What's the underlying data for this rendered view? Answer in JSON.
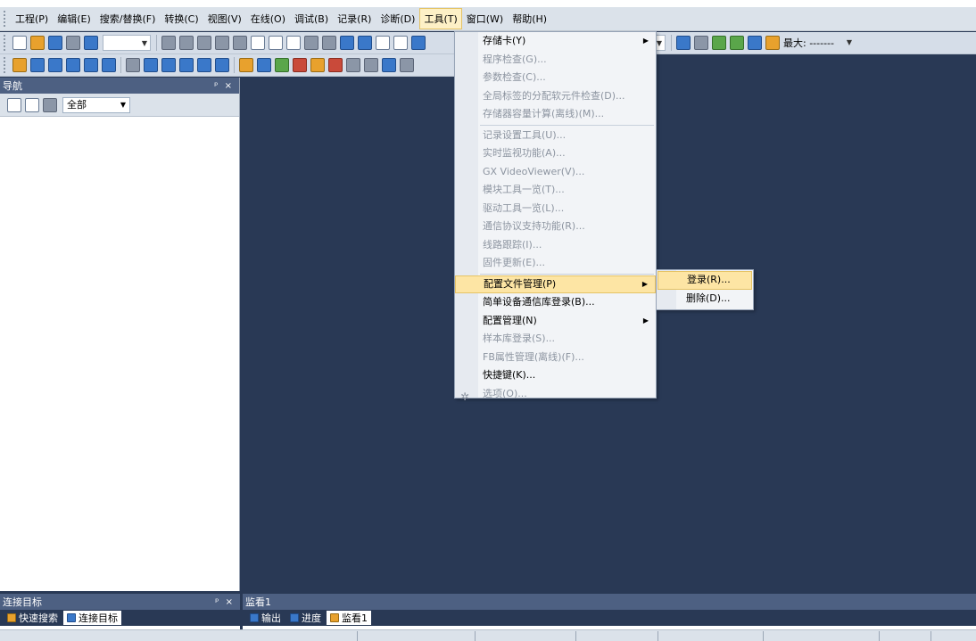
{
  "menubar": {
    "items": [
      "工程(P)",
      "编辑(E)",
      "搜索/替换(F)",
      "转换(C)",
      "视图(V)",
      "在线(O)",
      "调试(B)",
      "记录(R)",
      "诊断(D)",
      "工具(T)",
      "窗口(W)",
      "帮助(H)"
    ],
    "active_index": 9
  },
  "toolbar": {
    "max_label": "最大: -------"
  },
  "nav": {
    "title": "导航",
    "pin_close": "ᵖ ×",
    "filter_value": "全部"
  },
  "tools_menu": {
    "items": [
      {
        "label": "存储卡(Y)",
        "enabled": true,
        "submenu": true
      },
      {
        "label": "程序检查(G)...",
        "enabled": false
      },
      {
        "label": "参数检查(C)...",
        "enabled": false
      },
      {
        "label": "全局标签的分配软元件检查(D)...",
        "enabled": false
      },
      {
        "label": "存储器容量计算(离线)(M)...",
        "enabled": false
      },
      {
        "separator": true
      },
      {
        "label": "记录设置工具(U)...",
        "enabled": false
      },
      {
        "label": "实时监视功能(A)...",
        "enabled": false
      },
      {
        "label": "GX VideoViewer(V)...",
        "enabled": false
      },
      {
        "label": "模块工具一览(T)...",
        "enabled": false
      },
      {
        "label": "驱动工具一览(L)...",
        "enabled": false
      },
      {
        "label": "通信协议支持功能(R)...",
        "enabled": false
      },
      {
        "label": "线路跟踪(I)...",
        "enabled": false
      },
      {
        "label": "固件更新(E)...",
        "enabled": false
      },
      {
        "separator": true
      },
      {
        "label": "配置文件管理(P)",
        "enabled": true,
        "submenu": true,
        "highlighted": true
      },
      {
        "label": "简单设备通信库登录(B)...",
        "enabled": true
      },
      {
        "label": "配置管理(N)",
        "enabled": true,
        "submenu": true
      },
      {
        "label": "样本库登录(S)...",
        "enabled": false
      },
      {
        "label": "FB属性管理(离线)(F)...",
        "enabled": false
      },
      {
        "label": "快捷键(K)...",
        "enabled": true
      },
      {
        "label": "选项(O)...",
        "enabled": false,
        "icon": "gear-icon"
      }
    ]
  },
  "profile_submenu": {
    "items": [
      {
        "label": "登录(R)...",
        "highlighted": true
      },
      {
        "label": "删除(D)...",
        "highlighted": false
      }
    ]
  },
  "connection": {
    "title": "连接目标",
    "pin_close": "ᵖ ×",
    "tabs": [
      {
        "label": "快速搜索",
        "selected": false
      },
      {
        "label": "连接目标",
        "selected": true
      }
    ]
  },
  "watch": {
    "title": "监看1",
    "tabs": [
      {
        "label": "输出",
        "selected": false
      },
      {
        "label": "进度",
        "selected": false
      },
      {
        "label": "监看1",
        "selected": true
      }
    ]
  },
  "colors": {
    "workspace": "#293955",
    "panel_title": "#4d6082",
    "highlight": "#fde5a4"
  }
}
